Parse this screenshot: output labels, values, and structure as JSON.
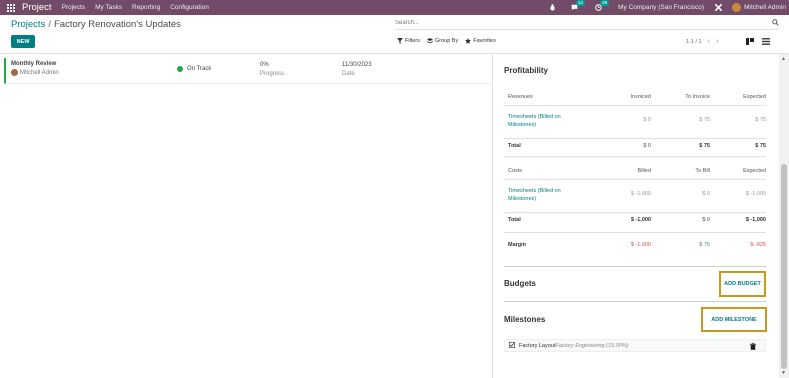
{
  "navbar": {
    "app_name": "Project",
    "menu": [
      "Projects",
      "My Tasks",
      "Reporting",
      "Configuration"
    ],
    "chat_badge": "12",
    "activity_badge": "29",
    "company": "My Company (San Francisco)",
    "user": "Mitchell Admin"
  },
  "breadcrumb": {
    "parent": "Projects",
    "separator": "/",
    "current": "Factory Renovation's Updates"
  },
  "toolbar": {
    "new_label": "NEW",
    "search_placeholder": "Search...",
    "filters_label": "Filters",
    "group_by_label": "Group By",
    "favorites_label": "Favorites",
    "pager_text": "1-1 / 1"
  },
  "update": {
    "title": "Monthly Review",
    "author": "Mitchell Admin",
    "status": "On Track",
    "progress_value": "0%",
    "progress_label": "Progress",
    "date_value": "11/30/2023",
    "date_label": "Date"
  },
  "profitability": {
    "title": "Profitability",
    "revenues_header": [
      "Revenues",
      "Invoiced",
      "To Invoice",
      "Expected"
    ],
    "revenue_rows": [
      {
        "label": "Timesheets (Billed on Milestones)",
        "invoiced": "$ 0",
        "to_invoice": "$ 75",
        "expected": "$ 75"
      }
    ],
    "revenue_total": {
      "label": "Total",
      "invoiced": "$ 0",
      "to_invoice": "$ 75",
      "expected": "$ 75"
    },
    "costs_header": [
      "Costs",
      "Billed",
      "To Bill",
      "Expected"
    ],
    "cost_rows": [
      {
        "label": "Timesheets (Billed on Milestones)",
        "billed": "$ -1,000",
        "to_bill": "$ 0",
        "expected": "$ -1,000"
      }
    ],
    "cost_total": {
      "label": "Total",
      "billed": "$ -1,000",
      "to_bill": "$ 0",
      "expected": "$ -1,000"
    },
    "margin": {
      "label": "Margin",
      "billed": "$ -1,000",
      "to_bill": "$ 75",
      "expected": "$ -925"
    }
  },
  "budgets": {
    "title": "Budgets",
    "add_label": "ADD BUDGET"
  },
  "milestones": {
    "title": "Milestones",
    "add_label": "ADD MILESTONE",
    "items": [
      {
        "name": "Factory Layout",
        "detail": "Factory Engineering (15.00%)"
      }
    ]
  },
  "colors": {
    "navbar": "#714b67",
    "accent": "#017e84",
    "on_track": "#28a745",
    "negative": "#d9534f",
    "highlight_border": "#c79a1e"
  }
}
